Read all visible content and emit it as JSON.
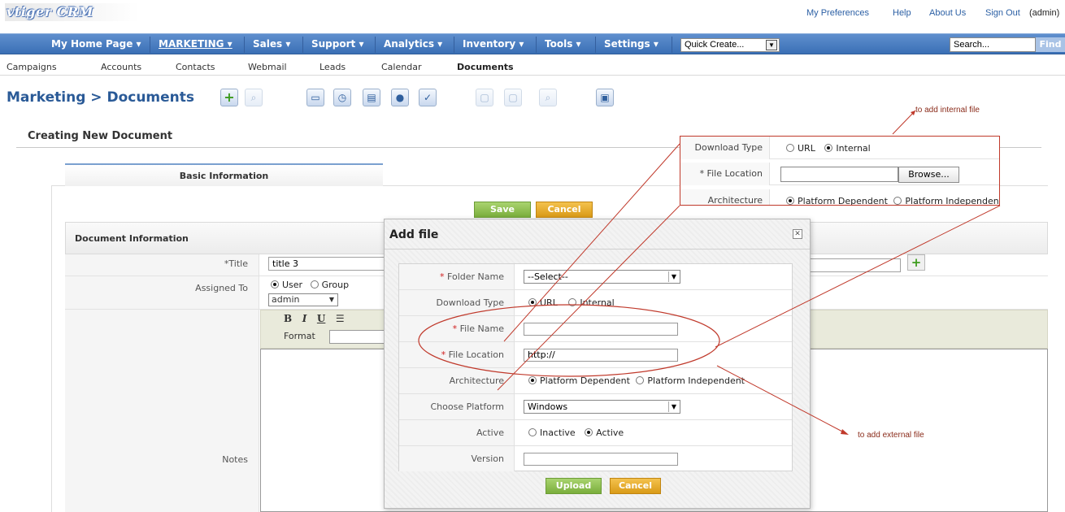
{
  "app": {
    "logo": "vtiger CRM"
  },
  "top_links": {
    "preferences": "My Preferences",
    "help": "Help",
    "about": "About Us",
    "sign_out": "Sign Out",
    "user": "(admin)"
  },
  "nav": {
    "items": [
      "My Home Page ▾",
      "MARKETING ▾",
      "Sales ▾",
      "Support ▾",
      "Analytics ▾",
      "Inventory ▾",
      "Tools ▾",
      "Settings ▾"
    ],
    "quick_create": "Quick Create...",
    "search_placeholder": "Search...",
    "find": "Find"
  },
  "subnav": {
    "items": [
      "Campaigns",
      "Accounts",
      "Contacts",
      "Webmail",
      "Leads",
      "Calendar",
      "Documents"
    ]
  },
  "page": {
    "title": "Marketing > Documents"
  },
  "form": {
    "heading": "Creating New Document",
    "tab": "Basic Information",
    "save": "Save",
    "cancel": "Cancel",
    "section": "Document Information",
    "title_label": "*Title",
    "title_value": "title 3",
    "assigned_label": "Assigned To",
    "user": "User",
    "group": "Group",
    "assigned_value": "admin",
    "rte_format": "Format",
    "notes_label": "Notes"
  },
  "internal_panel": {
    "download_type_label": "Download Type",
    "url": "URL",
    "internal": "Internal",
    "file_location_label": "* File Location",
    "browse": "Browse...",
    "architecture_label": "Architecture",
    "platform_dependent": "Platform Dependent",
    "platform_independent": "Platform Independent"
  },
  "modal": {
    "title": "Add file",
    "folder_name_label": "Folder Name",
    "folder_value": "--Select--",
    "download_type_label": "Download Type",
    "url": "URL",
    "internal": "Internal",
    "file_name_label": "File Name",
    "file_location_label": "File Location",
    "file_location_value": "http://",
    "architecture_label": "Architecture",
    "platform_dependent": "Platform Dependent",
    "platform_independent": "Platform Independent",
    "choose_platform_label": "Choose Platform",
    "platform_value": "Windows",
    "active_label": "Active",
    "inactive": "Inactive",
    "active": "Active",
    "version_label": "Version",
    "upload": "Upload",
    "cancel": "Cancel"
  },
  "annotations": {
    "internal": "to add internal file",
    "external": "to add external file"
  },
  "colors": {
    "nav_blue": "#3a6fb5",
    "title_blue": "#2a5a97",
    "save_green": "#7aae3c",
    "cancel_orange": "#d99a17",
    "annotation_red": "#c0392b"
  }
}
